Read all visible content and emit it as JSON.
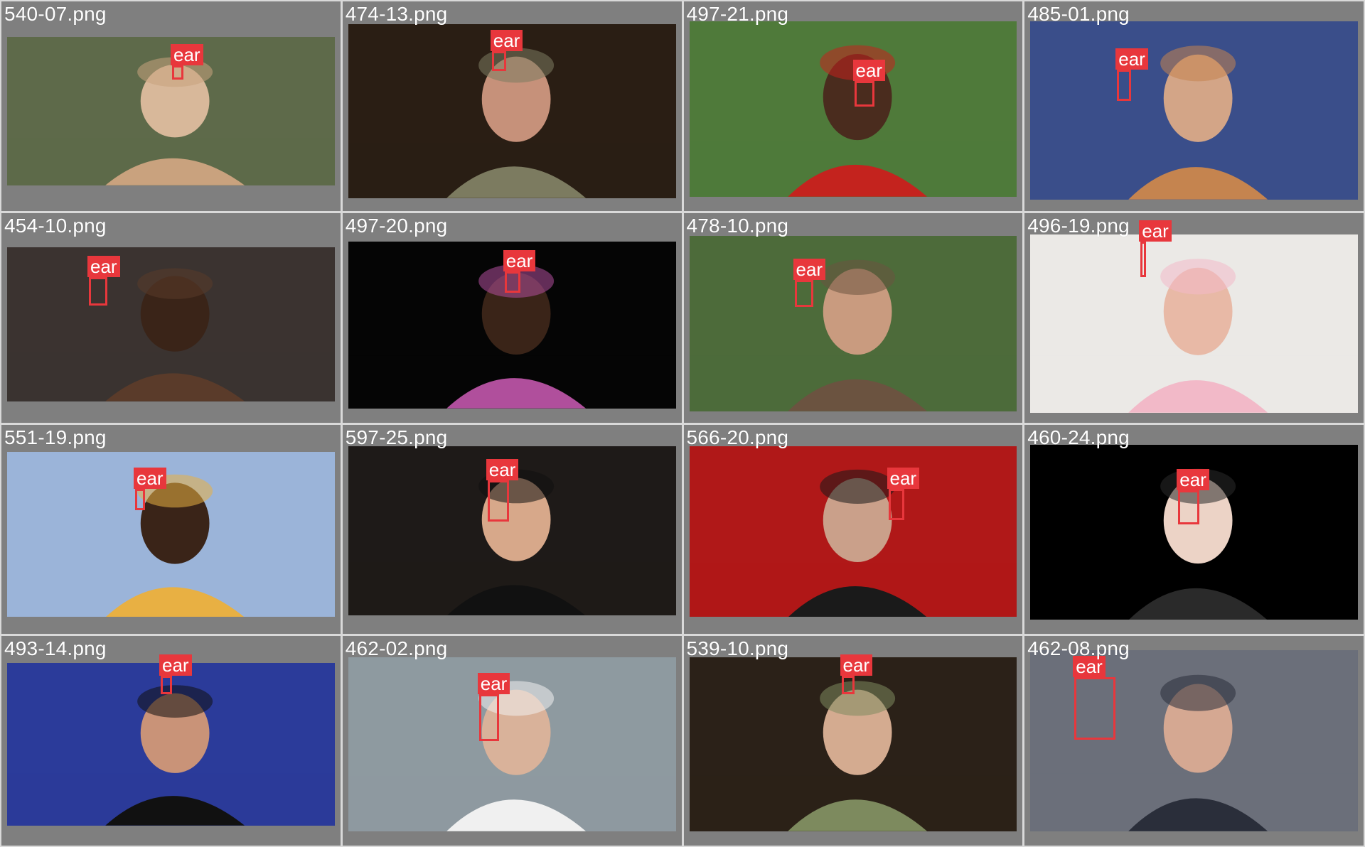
{
  "grid": {
    "cells": [
      {
        "filename": "540-07.png",
        "label": "ear",
        "bg": "#5e6a4a",
        "accent": "#c9a27e",
        "subject": "#d8b89a"
      },
      {
        "filename": "474-13.png",
        "label": "ear",
        "bg": "#2a1e14",
        "accent": "#7c7b60",
        "subject": "#c6917a"
      },
      {
        "filename": "497-21.png",
        "label": "ear",
        "bg": "#4f7a3a",
        "accent": "#c4231e",
        "subject": "#4a2c1e"
      },
      {
        "filename": "485-01.png",
        "label": "ear",
        "bg": "#3a4e8a",
        "accent": "#c5844f",
        "subject": "#d3a587"
      },
      {
        "filename": "454-10.png",
        "label": "ear",
        "bg": "#3b3330",
        "accent": "#5a3b2a",
        "subject": "#3a2418"
      },
      {
        "filename": "497-20.png",
        "label": "ear",
        "bg": "#050505",
        "accent": "#b04f9c",
        "subject": "#3a2418"
      },
      {
        "filename": "478-10.png",
        "label": "ear",
        "bg": "#4d6b3a",
        "accent": "#6b5340",
        "subject": "#c99b7f"
      },
      {
        "filename": "496-19.png",
        "label": "ear",
        "bg": "#ebe9e6",
        "accent": "#f2b9c8",
        "subject": "#e8b9a6"
      },
      {
        "filename": "551-19.png",
        "label": "ear",
        "bg": "#9bb4d9",
        "accent": "#e8b043",
        "subject": "#3a2418"
      },
      {
        "filename": "597-25.png",
        "label": "ear",
        "bg": "#1e1a18",
        "accent": "#111111",
        "subject": "#d7a88a"
      },
      {
        "filename": "566-20.png",
        "label": "ear",
        "bg": "#b01818",
        "accent": "#1a1a1a",
        "subject": "#caa08a"
      },
      {
        "filename": "460-24.png",
        "label": "ear",
        "bg": "#000000",
        "accent": "#2a2a2a",
        "subject": "#ecd3c6"
      },
      {
        "filename": "493-14.png",
        "label": "ear",
        "bg": "#2b3b9a",
        "accent": "#111111",
        "subject": "#c99378"
      },
      {
        "filename": "462-02.png",
        "label": "ear",
        "bg": "#8e9aa0",
        "accent": "#f0f0f0",
        "subject": "#d9b29a"
      },
      {
        "filename": "539-10.png",
        "label": "ear",
        "bg": "#2b2118",
        "accent": "#7d8a5e",
        "subject": "#d4ab90"
      },
      {
        "filename": "462-08.png",
        "label": "ear",
        "bg": "#6b6f7a",
        "accent": "#2a2e3a",
        "subject": "#d5a892"
      }
    ]
  }
}
